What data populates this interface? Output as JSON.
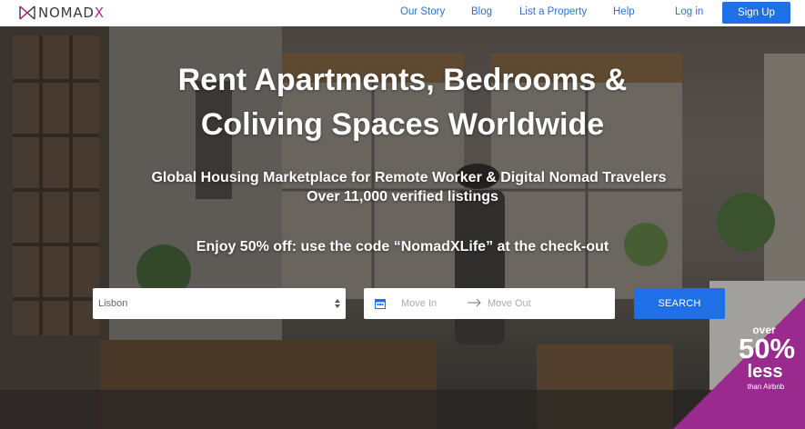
{
  "brand": {
    "logo_name": "NOMAD",
    "logo_x": "X",
    "accent_color": "#b8287f",
    "primary_color": "#1f6fe6"
  },
  "nav": {
    "links": [
      "Our Story",
      "Blog",
      "List a Property",
      "Help",
      "Log in"
    ],
    "signup_label": "Sign Up"
  },
  "hero": {
    "headline_line1": "Rent Apartments, Bedrooms &",
    "headline_line2": "Coliving Spaces Worldwide",
    "subheadline_line1": "Global Housing Marketplace for Remote Worker & Digital Nomad Travelers",
    "subheadline_line2": "Over 11,000 verified listings",
    "promo": "Enjoy 50% off: use the code “NomadXLife” at the check-out"
  },
  "search": {
    "city_value": "Lisbon",
    "move_in_placeholder": "Move In",
    "move_out_placeholder": "Move Out",
    "button_label": "SEARCH",
    "calendar_icon": "calendar-icon"
  },
  "badge": {
    "line1": "over",
    "line2": "50%",
    "line3": "less",
    "line4": "than Airbnb",
    "color": "#9a2a8e"
  }
}
